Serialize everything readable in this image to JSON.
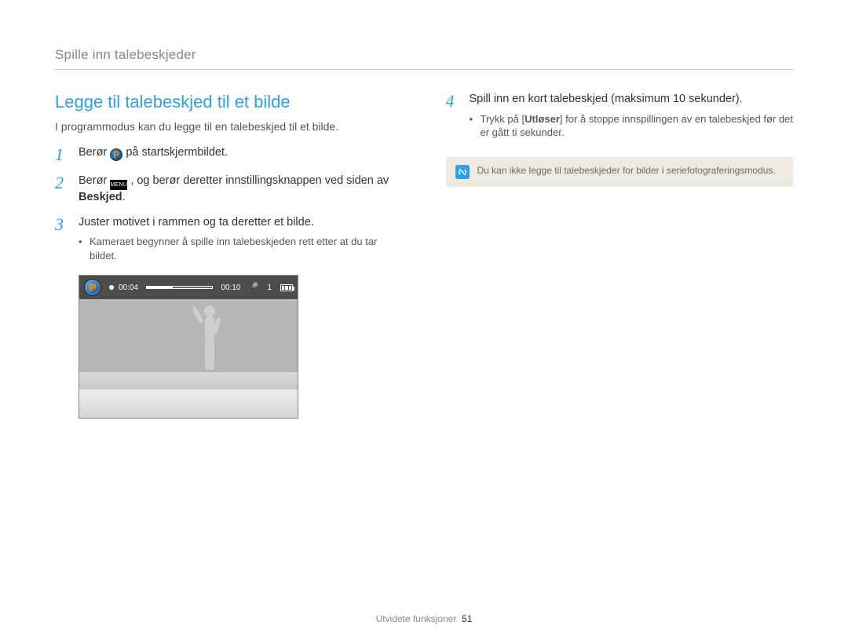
{
  "header": {
    "breadcrumb": "Spille inn talebeskjeder"
  },
  "section": {
    "title": "Legge til talebeskjed til et bilde",
    "lead": "I programmodus kan du legge til en talebeskjed til et bilde."
  },
  "steps": {
    "s1": {
      "num": "1",
      "pre": "Berør ",
      "post": " på startskjermbildet."
    },
    "s2": {
      "num": "2",
      "pre": "Berør ",
      "mid": " , og berør deretter innstillingsknappen ved siden av ",
      "bold": "Beskjed",
      "post": "."
    },
    "s3": {
      "num": "3",
      "text": "Juster motivet i rammen og ta deretter et bilde.",
      "bullet": "Kameraet begynner å spille inn talebeskjeden rett etter at du tar bildet."
    },
    "s4": {
      "num": "4",
      "text": "Spill inn en kort talebeskjed (maksimum 10 sekunder).",
      "bullet_pre": "Trykk på [",
      "bullet_bold": "Utløser",
      "bullet_post": "] for å stoppe innspillingen av en talebeskjed før det er gått ti sekunder."
    }
  },
  "icons": {
    "p_label": "P",
    "menu_label": "MENU"
  },
  "screenshot": {
    "elapsed": "00:04",
    "total": "00:10",
    "count": "1"
  },
  "note": {
    "text": "Du kan ikke legge til talebeskjeder for bilder i seriefotograferingsmodus."
  },
  "footer": {
    "section": "Utvidete funksjoner",
    "page": "51"
  }
}
